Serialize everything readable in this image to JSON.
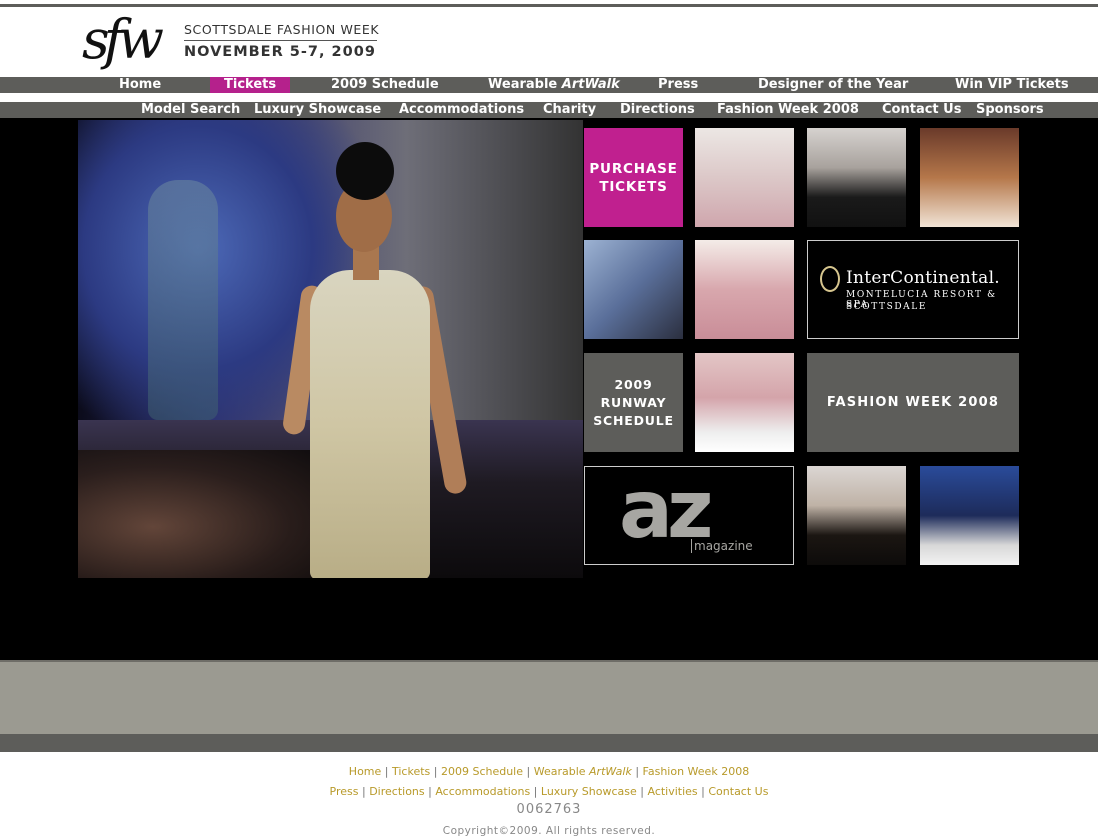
{
  "header": {
    "logo_script": "sfw",
    "title": "SCOTTSDALE FASHION WEEK",
    "dates": "NOVEMBER 5-7, 2009"
  },
  "nav_primary": [
    {
      "label": "Home"
    },
    {
      "label": "Tickets",
      "active": true
    },
    {
      "label": "2009 Schedule"
    },
    {
      "label_prefix": "Wearable ",
      "label_em": "ArtWalk"
    },
    {
      "label": "Press"
    },
    {
      "label": "Designer of the Year"
    },
    {
      "label": "Win VIP Tickets"
    }
  ],
  "nav_secondary": [
    {
      "label": "Model Search"
    },
    {
      "label": "Luxury Showcase"
    },
    {
      "label": "Accommodations"
    },
    {
      "label": "Charity"
    },
    {
      "label": "Directions"
    },
    {
      "label": "Fashion Week 2008"
    },
    {
      "label": "Contact Us"
    },
    {
      "label": "Sponsors"
    }
  ],
  "tiles": {
    "purchase_tickets": "PURCHASE\nTICKETS",
    "runway_schedule": "2009\nRUNWAY\nSCHEDULE",
    "fashion_week_2008": "FASHION WEEK 2008",
    "intercontinental": {
      "name": "InterContinental.",
      "line1": "MONTELUCIA RESORT & SPA",
      "line2": "SCOTTSDALE"
    },
    "az": {
      "big": "az",
      "small": "magazine"
    }
  },
  "footer": {
    "row1": [
      "Home",
      "Tickets",
      "2009 Schedule",
      "Wearable ",
      "ArtWalk",
      "Fashion Week 2008"
    ],
    "row2": [
      "Press",
      "Directions",
      "Accommodations",
      "Luxury Showcase",
      "Activities",
      "Contact Us"
    ],
    "counter": "0062763",
    "copyright": "Copyright©2009. All rights reserved."
  },
  "colors": {
    "accent": "#c0208f",
    "nav_bar": "#5d5d5a",
    "footer_link": "#b89a2a"
  }
}
